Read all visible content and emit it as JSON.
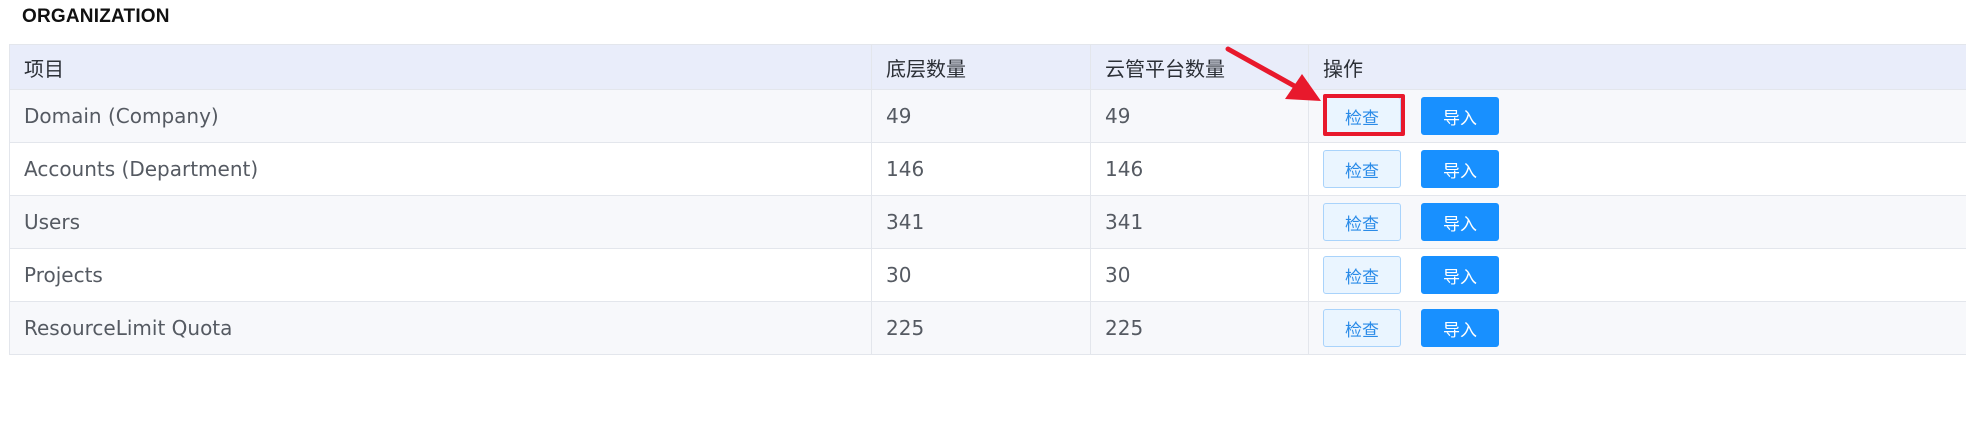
{
  "section": {
    "title": "ORGANIZATION"
  },
  "table": {
    "columns": [
      "项目",
      "底层数量",
      "云管平台数量",
      "操作"
    ],
    "rows": [
      {
        "item": "Domain (Company)",
        "base_count": "49",
        "cloud_count": "49",
        "check_label": "检查",
        "import_label": "导入"
      },
      {
        "item": "Accounts (Department)",
        "base_count": "146",
        "cloud_count": "146",
        "check_label": "检查",
        "import_label": "导入"
      },
      {
        "item": "Users",
        "base_count": "341",
        "cloud_count": "341",
        "check_label": "检查",
        "import_label": "导入"
      },
      {
        "item": "Projects",
        "base_count": "30",
        "cloud_count": "30",
        "check_label": "检查",
        "import_label": "导入"
      },
      {
        "item": "ResourceLimit Quota",
        "base_count": "225",
        "cloud_count": "225",
        "check_label": "检查",
        "import_label": "导入"
      }
    ]
  },
  "annotation": {
    "highlight_color": "#e8192c",
    "target": "first-row-check-button"
  },
  "colors": {
    "header_bg": "#e9edfa",
    "check_bg": "#eaf5ff",
    "check_border": "#a9d3fb",
    "check_text": "#2a8be8",
    "import_bg": "#1890ff",
    "import_text": "#ffffff"
  }
}
